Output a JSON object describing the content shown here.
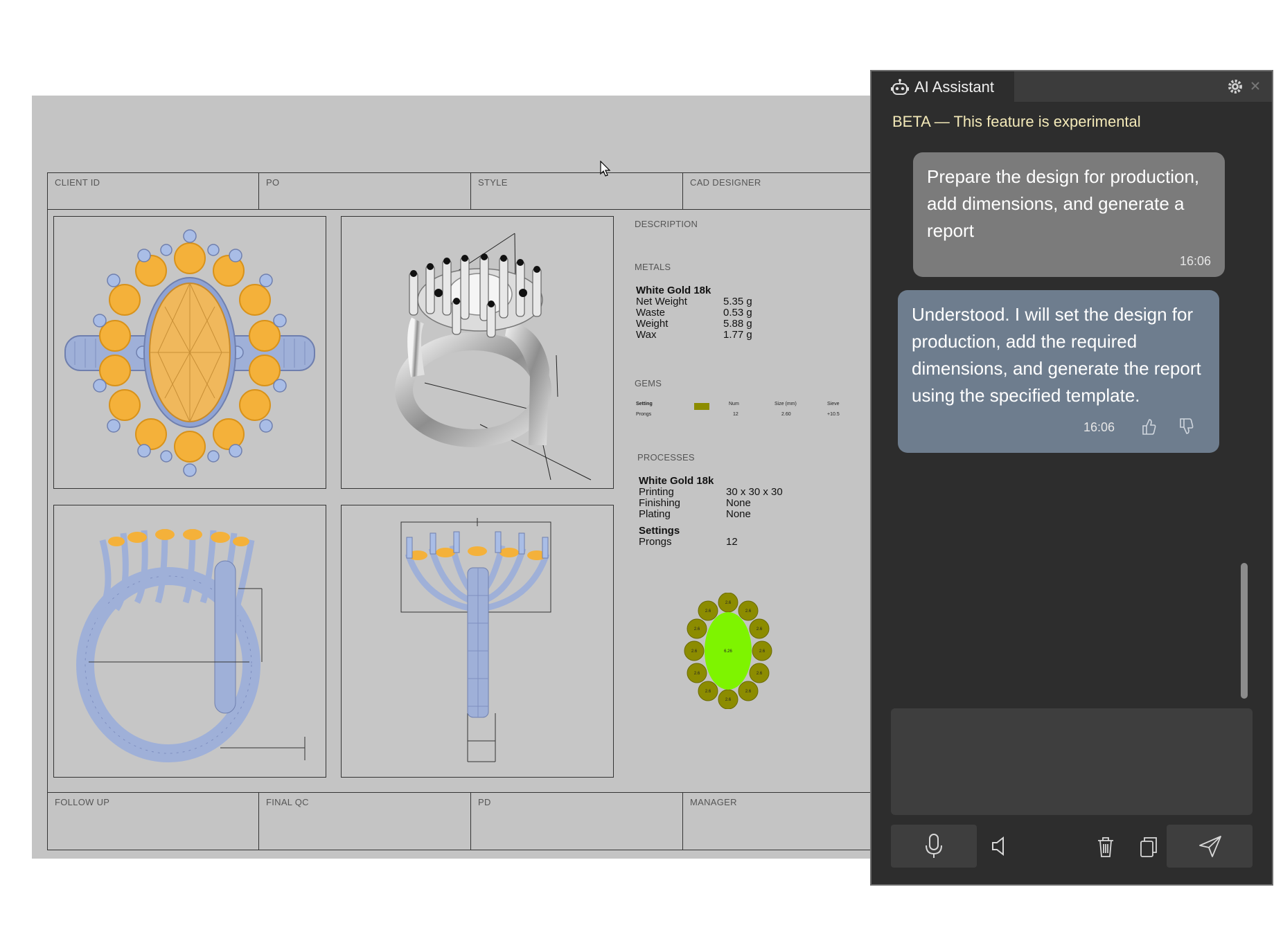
{
  "report": {
    "header_labels": [
      "CLIENT ID",
      "PO",
      "STYLE",
      "CAD DESIGNER"
    ],
    "footer_labels": [
      "FOLLOW UP",
      "FINAL QC",
      "PD",
      "MANAGER"
    ],
    "description_label": "DESCRIPTION",
    "metals": {
      "label": "METALS",
      "name": "White Gold 18k",
      "rows": [
        {
          "k": "Net Weight",
          "v": "5.35 g"
        },
        {
          "k": "Waste",
          "v": "0.53 g"
        },
        {
          "k": "Weight",
          "v": "5.88 g"
        },
        {
          "k": "Wax",
          "v": "1.77 g"
        }
      ]
    },
    "gems": {
      "label": "GEMS",
      "headers": [
        "Setting",
        "Num",
        "Size (mm)",
        "Sieve"
      ],
      "row": [
        "Prongs",
        "12",
        "2.60",
        "+10.5"
      ]
    },
    "processes": {
      "label": "PROCESSES",
      "name": "White Gold 18k",
      "rows": [
        {
          "k": "Printing",
          "v": "30 x 30 x 30"
        },
        {
          "k": "Finishing",
          "v": "None"
        },
        {
          "k": "Plating",
          "v": "None"
        }
      ],
      "settings_title": "Settings",
      "settings_rows": [
        {
          "k": "Prongs",
          "v": "12"
        }
      ]
    },
    "stone_map": {
      "center_label": "6.26",
      "side_labels": [
        "2.6",
        "2.6",
        "2.6",
        "2.6",
        "2.6",
        "2.6",
        "2.6",
        "2.6",
        "2.6",
        "2.6",
        "2.6",
        "2.6"
      ]
    }
  },
  "assistant": {
    "title": "AI Assistant",
    "beta_notice": "BETA — This feature is experimental",
    "user_message": "Prepare the design for production, add dimensions, and generate a report",
    "user_time": "16:06",
    "bot_message": "Understood. I will set the design for production, add the required dimensions, and generate the report using the specified template.",
    "bot_time": "16:06",
    "input_value": "",
    "icons": [
      "robot-icon",
      "gear-icon",
      "close-icon",
      "thumbs-up-icon",
      "thumbs-down-icon",
      "microphone-icon",
      "speaker-icon",
      "trash-icon",
      "copy-icon",
      "send-icon"
    ]
  },
  "colors": {
    "sheet_bg": "#c4c4c4",
    "gold_stone": "#f4b13a",
    "metal_blue": "#9fb0d8",
    "center_stone": "#7ef400",
    "side_stone": "#8c8c00",
    "panel_bg": "#2d2d2d",
    "user_bubble": "#7b7b7b",
    "bot_bubble": "#6e7d8e",
    "beta_text": "#f3e9b8"
  }
}
